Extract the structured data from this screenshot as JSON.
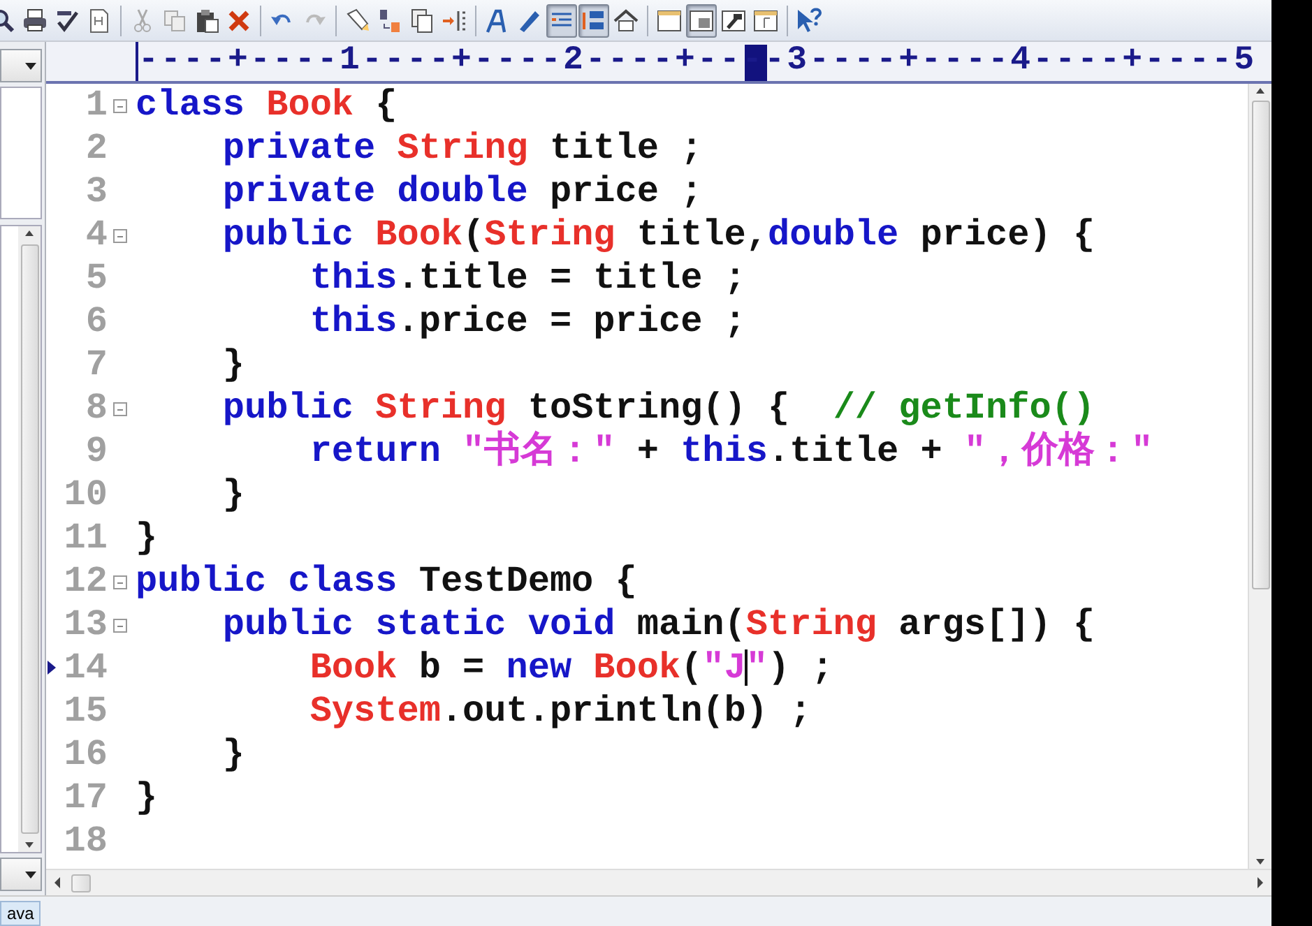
{
  "toolbar": [
    {
      "kind": "preview",
      "pressed": false
    },
    {
      "kind": "print",
      "pressed": false
    },
    {
      "kind": "spellcheck",
      "pressed": false
    },
    {
      "kind": "document",
      "pressed": false
    },
    {
      "kind": "separator"
    },
    {
      "kind": "cut",
      "pressed": false
    },
    {
      "kind": "copy",
      "pressed": false
    },
    {
      "kind": "paste",
      "pressed": false
    },
    {
      "kind": "delete",
      "pressed": false
    },
    {
      "kind": "separator"
    },
    {
      "kind": "undo",
      "pressed": false
    },
    {
      "kind": "redo",
      "pressed": false
    },
    {
      "kind": "separator"
    },
    {
      "kind": "find",
      "pressed": false
    },
    {
      "kind": "replace",
      "pressed": false
    },
    {
      "kind": "pages",
      "pressed": false
    },
    {
      "kind": "indent",
      "pressed": false
    },
    {
      "kind": "separator"
    },
    {
      "kind": "font",
      "pressed": false
    },
    {
      "kind": "pen",
      "pressed": false
    },
    {
      "kind": "wrap",
      "pressed": true
    },
    {
      "kind": "numbers",
      "pressed": true
    },
    {
      "kind": "home",
      "pressed": false
    },
    {
      "kind": "separator"
    },
    {
      "kind": "window",
      "pressed": false
    },
    {
      "kind": "panel",
      "pressed": true
    },
    {
      "kind": "hammer",
      "pressed": false
    },
    {
      "kind": "frame",
      "pressed": false
    },
    {
      "kind": "separator"
    },
    {
      "kind": "help",
      "pressed": false
    }
  ],
  "ruler": "----+----1----+----2----+----3----+----4----+----5",
  "lines": [
    {
      "number": "1",
      "fold": true,
      "current": false,
      "tokens": [
        {
          "t": "class ",
          "kind": "kw"
        },
        {
          "t": "Book",
          "kind": "type"
        },
        {
          "t": " {",
          "kind": "plain"
        }
      ]
    },
    {
      "number": "2",
      "fold": false,
      "current": false,
      "tokens": [
        {
          "t": "    private ",
          "kind": "kw"
        },
        {
          "t": "String",
          "kind": "type"
        },
        {
          "t": " title ;",
          "kind": "plain"
        }
      ]
    },
    {
      "number": "3",
      "fold": false,
      "current": false,
      "tokens": [
        {
          "t": "    private double",
          "kind": "kw"
        },
        {
          "t": " price ;",
          "kind": "plain"
        }
      ]
    },
    {
      "number": "4",
      "fold": true,
      "current": false,
      "tokens": [
        {
          "t": "    public ",
          "kind": "kw"
        },
        {
          "t": "Book",
          "kind": "type"
        },
        {
          "t": "(",
          "kind": "plain"
        },
        {
          "t": "String",
          "kind": "type"
        },
        {
          "t": " title,",
          "kind": "plain"
        },
        {
          "t": "double",
          "kind": "kw"
        },
        {
          "t": " price) {",
          "kind": "plain"
        }
      ]
    },
    {
      "number": "5",
      "fold": false,
      "current": false,
      "tokens": [
        {
          "t": "        this",
          "kind": "kw"
        },
        {
          "t": ".title = title ;",
          "kind": "plain"
        }
      ]
    },
    {
      "number": "6",
      "fold": false,
      "current": false,
      "tokens": [
        {
          "t": "        this",
          "kind": "kw"
        },
        {
          "t": ".price = price ;",
          "kind": "plain"
        }
      ]
    },
    {
      "number": "7",
      "fold": false,
      "current": false,
      "tokens": [
        {
          "t": "    }",
          "kind": "plain"
        }
      ]
    },
    {
      "number": "8",
      "fold": true,
      "current": false,
      "tokens": [
        {
          "t": "    public ",
          "kind": "kw"
        },
        {
          "t": "String",
          "kind": "type"
        },
        {
          "t": " toString() {  ",
          "kind": "plain"
        },
        {
          "t": "// getInfo()",
          "kind": "comment"
        }
      ]
    },
    {
      "number": "9",
      "fold": false,
      "current": false,
      "tokens": [
        {
          "t": "        return ",
          "kind": "kw"
        },
        {
          "t": "\"书名：\"",
          "kind": "str"
        },
        {
          "t": " + ",
          "kind": "plain"
        },
        {
          "t": "this",
          "kind": "kw"
        },
        {
          "t": ".title + ",
          "kind": "plain"
        },
        {
          "t": "\"，价格：\"",
          "kind": "str"
        }
      ]
    },
    {
      "number": "10",
      "fold": false,
      "current": false,
      "tokens": [
        {
          "t": "    }",
          "kind": "plain"
        }
      ]
    },
    {
      "number": "11",
      "fold": false,
      "current": false,
      "tokens": [
        {
          "t": "}",
          "kind": "plain"
        }
      ]
    },
    {
      "number": "12",
      "fold": true,
      "current": false,
      "tokens": [
        {
          "t": "public class",
          "kind": "kw"
        },
        {
          "t": " TestDemo {",
          "kind": "plain"
        }
      ]
    },
    {
      "number": "13",
      "fold": true,
      "current": false,
      "tokens": [
        {
          "t": "    public static void",
          "kind": "kw"
        },
        {
          "t": " main(",
          "kind": "plain"
        },
        {
          "t": "String",
          "kind": "type"
        },
        {
          "t": " args[]) {",
          "kind": "plain"
        }
      ]
    },
    {
      "number": "14",
      "fold": false,
      "current": true,
      "tokens": [
        {
          "t": "        Book",
          "kind": "type"
        },
        {
          "t": " b = ",
          "kind": "plain"
        },
        {
          "t": "new",
          "kind": "kw"
        },
        {
          "t": " Book",
          "kind": "type"
        },
        {
          "t": "(",
          "kind": "plain"
        },
        {
          "t": "\"J",
          "kind": "str",
          "caret_after": true
        },
        {
          "t": "\"",
          "kind": "str"
        },
        {
          "t": ") ;",
          "kind": "plain"
        }
      ]
    },
    {
      "number": "15",
      "fold": false,
      "current": false,
      "tokens": [
        {
          "t": "        System",
          "kind": "type"
        },
        {
          "t": ".out.println(b) ;",
          "kind": "plain"
        }
      ]
    },
    {
      "number": "16",
      "fold": false,
      "current": false,
      "tokens": [
        {
          "t": "    }",
          "kind": "plain"
        }
      ]
    },
    {
      "number": "17",
      "fold": false,
      "current": false,
      "tokens": [
        {
          "t": "}",
          "kind": "plain"
        }
      ]
    },
    {
      "number": "18",
      "fold": false,
      "current": false
    }
  ],
  "status_bar": {
    "tab": "ava"
  }
}
